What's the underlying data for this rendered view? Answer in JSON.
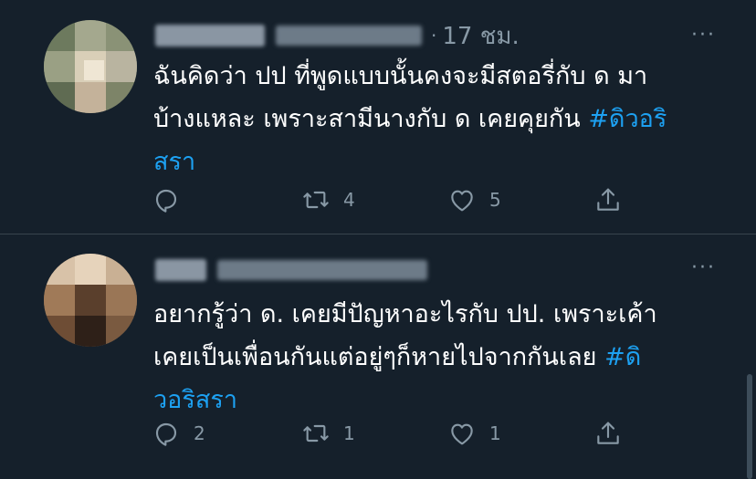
{
  "tweets": [
    {
      "author_name": "",
      "author_handle": "",
      "time": "17 ชม.",
      "more": "···",
      "text": "ฉันคิดว่า ปป ที่พูดแบบนั้นคงจะมีสตอรี่กับ ด มา\nบ้างแหละ เพราะสามีนางกับ ด เคยคุยกัน ",
      "hashtag": "#ดิวอริ\nสรา",
      "reply_count": "",
      "retweet_count": "4",
      "like_count": "5",
      "avatar_color": "#8e9a7a"
    },
    {
      "author_name": "",
      "author_handle": "",
      "time": "",
      "more": "···",
      "text": "อยากรู้ว่า ด. เคยมีปัญหาอะไรกับ ปป. เพราะเค้า\nเคยเป็นเพื่อนกันแต่อยู่ๆก็หายไปจากกันเลย  ",
      "hashtag": "#ดิ\nวอริสรา",
      "reply_count": "2",
      "retweet_count": "1",
      "like_count": "1",
      "avatar_color": "#9c7a5e"
    }
  ],
  "colors": {
    "background": "#15202b",
    "text": "#ffffff",
    "muted": "#8899a6",
    "link": "#1da1f2",
    "divider": "#38444d"
  },
  "icons": {
    "reply": "reply-icon",
    "retweet": "retweet-icon",
    "like": "like-icon",
    "share": "share-icon",
    "more": "more-icon"
  }
}
